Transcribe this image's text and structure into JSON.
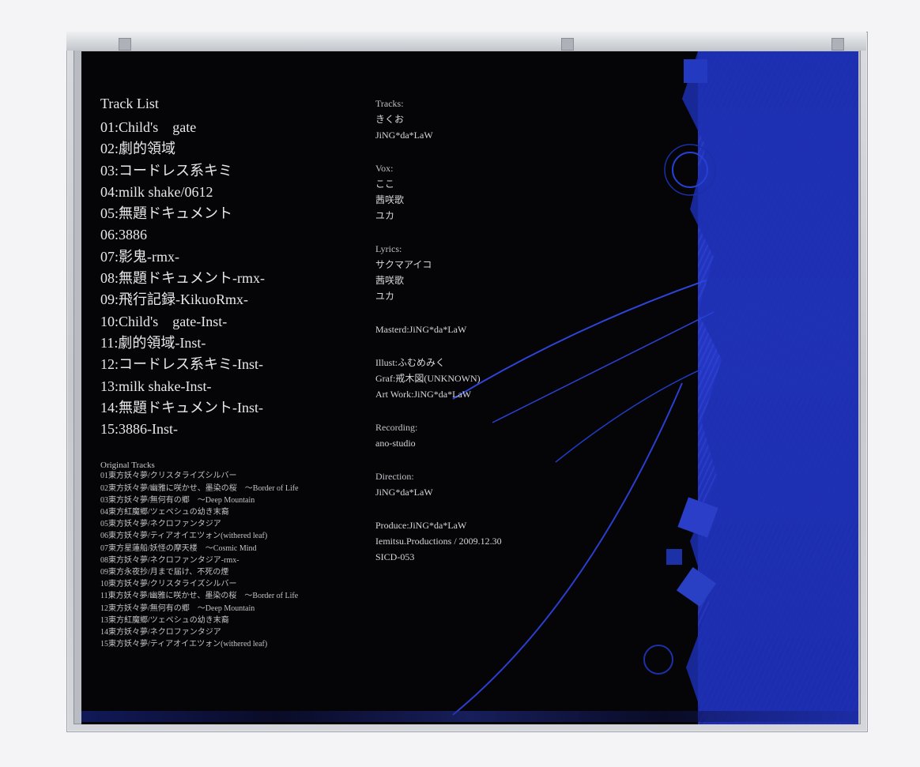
{
  "tracklist": {
    "title": "Track List",
    "tracks": [
      "01:Child's　gate",
      "02:劇的領域",
      "03:コードレス系キミ",
      "04:milk shake/0612",
      "05:無題ドキュメント",
      "06:3886",
      "07:影鬼-rmx-",
      "08:無題ドキュメント-rmx-",
      "09:飛行記録-KikuoRmx-",
      "10:Child's　gate-Inst-",
      "11:劇的領域-Inst-",
      "12:コードレス系キミ-Inst-",
      "13:milk shake-Inst-",
      "14:無題ドキュメント-Inst-",
      "15:3886-Inst-"
    ]
  },
  "original": {
    "title": "Original Tracks",
    "lines": [
      "01東方妖々夢/クリスタライズシルバー",
      "02東方妖々夢/幽雅に咲かせ、墨染の桜　～Border of Life",
      "03東方妖々夢/無何有の郷　～Deep Mountain",
      "04東方紅魔郷/ツェペシュの幼き末裔",
      "05東方妖々夢/ネクロファンタジア",
      "06東方妖々夢/ティアオイエツォン(withered leaf)",
      "07東方星蓮船/妖怪の摩天楼　～Cosmic Mind",
      "08東方妖々夢/ネクロファンタジア-rmx-",
      "09東方永夜抄/月まで届け、不死の煙",
      "10東方妖々夢/クリスタライズシルバー",
      "11東方妖々夢/幽雅に咲かせ、墨染の桜　～Border of Life",
      "12東方妖々夢/無何有の郷　～Deep Mountain",
      "13東方紅魔郷/ツェペシュの幼き末裔",
      "14東方妖々夢/ネクロファンタジア",
      "15東方妖々夢/ティアオイエツォン(withered leaf)"
    ]
  },
  "credits": {
    "tracks_label": "Tracks:",
    "tracks": [
      "きくお",
      "JiNG*da*LaW"
    ],
    "vox_label": "Vox:",
    "vox": [
      "ここ",
      "茜咲歌",
      "ユカ"
    ],
    "lyrics_label": "Lyrics:",
    "lyrics": [
      "サクマアイコ",
      "茜咲歌",
      "ユカ"
    ],
    "mastered": "Masterd:JiNG*da*LaW",
    "illust": "Illust:ふむめみく",
    "graf": "Graf:戒木図(UNKNOWN)",
    "artwork": "Art Work:JiNG*da*LaW",
    "recording_label": "Recording:",
    "recording": "ano-studio",
    "direction_label": "Direction:",
    "direction": "JiNG*da*LaW",
    "produce": "Produce:JiNG*da*LaW",
    "label": "Iemitsu.Productions / 2009.12.30",
    "catalog": "SICD-053"
  },
  "colors": {
    "panel_blue": "#2336c6",
    "background": "#050507",
    "text": "#e8e8ec"
  }
}
